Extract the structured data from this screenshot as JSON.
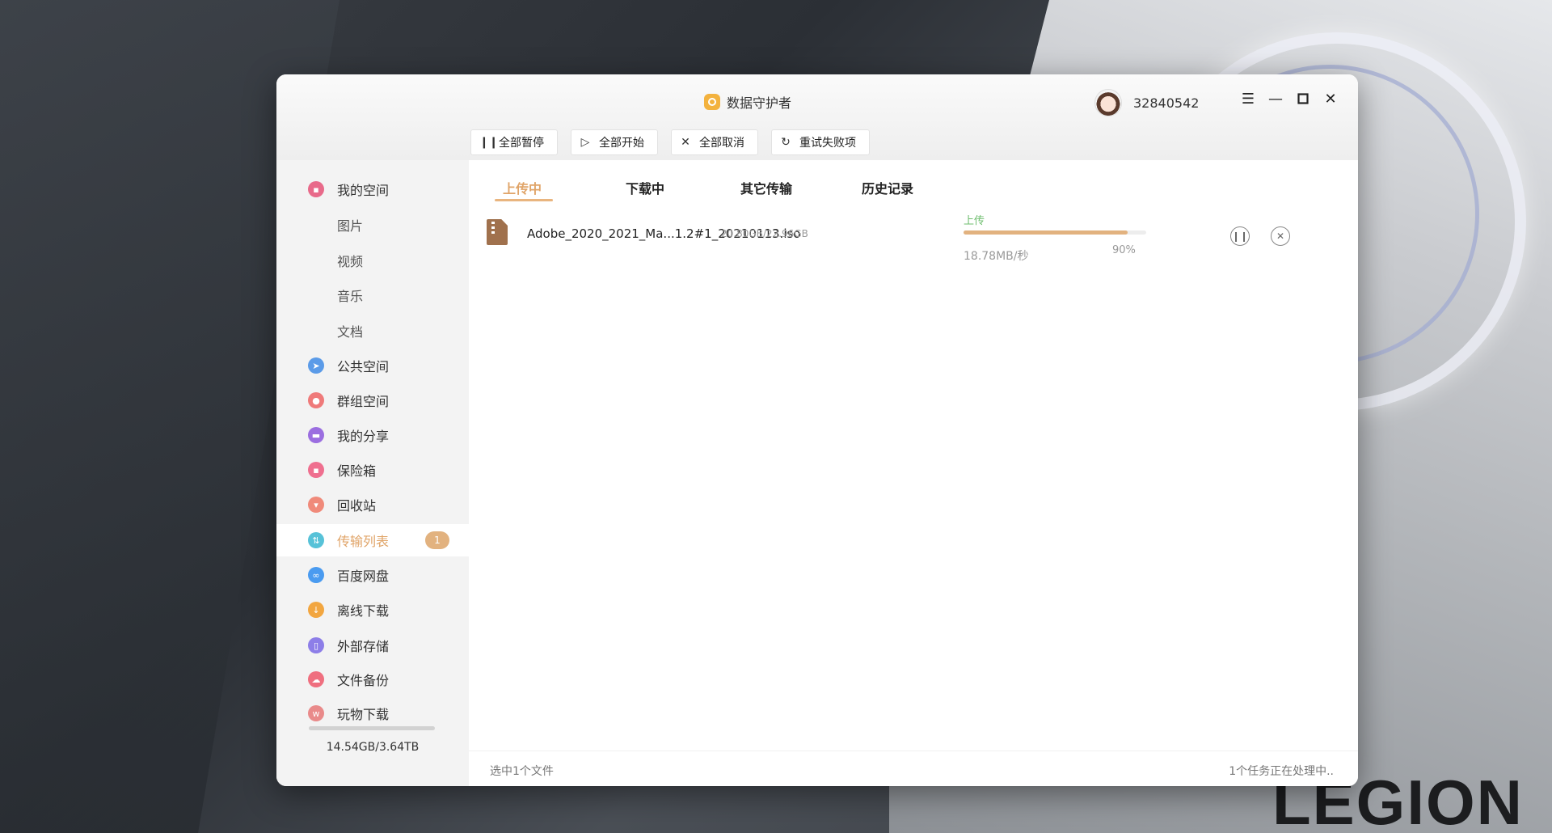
{
  "app": {
    "title": "数据守护者",
    "user_id": "32840542"
  },
  "toolbar": {
    "pause_all": "全部暂停",
    "start_all": "全部开始",
    "cancel_all": "全部取消",
    "retry_failed": "重试失败项"
  },
  "sidebar": {
    "items": [
      {
        "label": "我的空间",
        "icon": "my-space-icon",
        "color": "#e86a8a"
      },
      {
        "label": "图片"
      },
      {
        "label": "视频"
      },
      {
        "label": "音乐"
      },
      {
        "label": "文档"
      },
      {
        "label": "公共空间",
        "icon": "public-space-icon",
        "color": "#5b9be8"
      },
      {
        "label": "群组空间",
        "icon": "group-space-icon",
        "color": "#ef7a7a"
      },
      {
        "label": "我的分享",
        "icon": "my-share-icon",
        "color": "#9b6ee0"
      },
      {
        "label": "保险箱",
        "icon": "safe-box-icon",
        "color": "#ef6f8f"
      },
      {
        "label": "回收站",
        "icon": "recycle-bin-icon",
        "color": "#f08a7a"
      },
      {
        "label": "传输列表",
        "icon": "transfer-list-icon",
        "color": "#57c2d8",
        "badge": "1"
      },
      {
        "label": "百度网盘",
        "icon": "baidu-netdisk-icon",
        "color": "#4a9bf0"
      },
      {
        "label": "离线下载",
        "icon": "offline-download-icon",
        "color": "#f2a640"
      },
      {
        "label": "外部存储",
        "icon": "external-storage-icon",
        "color": "#8d7ee8"
      },
      {
        "label": "文件备份",
        "icon": "file-backup-icon",
        "color": "#ef6f7f"
      },
      {
        "label": "玩物下载",
        "icon": "wanwu-download-icon",
        "color": "#e98a8a"
      }
    ],
    "storage": "14.54GB/3.64TB"
  },
  "tabs": [
    "上传中",
    "下载中",
    "其它传输",
    "历史记录"
  ],
  "transfer": {
    "file_name": "Adobe_2020_2021_Ma...1.2#1_20210113.iso",
    "size": "20.80GB/22.96GB",
    "status": "上传",
    "speed": "18.78MB/秒",
    "percent_label": "90%",
    "progress": 0.9
  },
  "footer": {
    "left": "选中1个文件",
    "right": "1个任务正在处理中.."
  },
  "brand": "LEGION"
}
